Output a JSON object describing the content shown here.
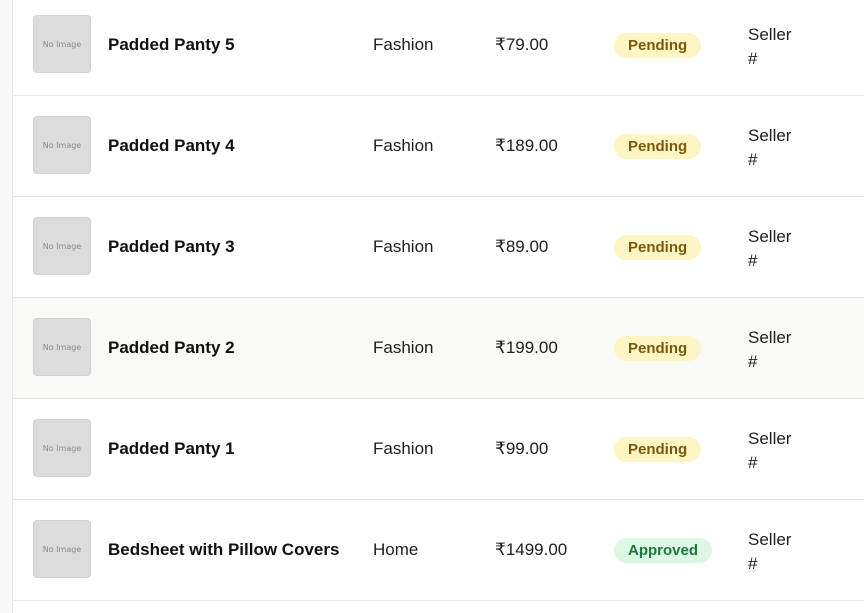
{
  "no_image_label": "No Image",
  "colors": {
    "pending_bg": "#fdf5c4",
    "pending_text": "#7a5a0a",
    "approved_bg": "#dcf7e4",
    "approved_text": "#1c7a3a"
  },
  "rows": [
    {
      "name": "Padded Panty 5",
      "category": "Fashion",
      "price": "₹79.00",
      "status": "Pending",
      "seller_line1": "Seller",
      "seller_line2": "#"
    },
    {
      "name": "Padded Panty 4",
      "category": "Fashion",
      "price": "₹189.00",
      "status": "Pending",
      "seller_line1": "Seller",
      "seller_line2": "#"
    },
    {
      "name": "Padded Panty 3",
      "category": "Fashion",
      "price": "₹89.00",
      "status": "Pending",
      "seller_line1": "Seller",
      "seller_line2": "#"
    },
    {
      "name": "Padded Panty 2",
      "category": "Fashion",
      "price": "₹199.00",
      "status": "Pending",
      "seller_line1": "Seller",
      "seller_line2": "#"
    },
    {
      "name": "Padded Panty 1",
      "category": "Fashion",
      "price": "₹99.00",
      "status": "Pending",
      "seller_line1": "Seller",
      "seller_line2": "#"
    },
    {
      "name": "Bedsheet with Pillow Covers",
      "category": "Home",
      "price": "₹1499.00",
      "status": "Approved",
      "seller_line1": "Seller",
      "seller_line2": "#"
    }
  ]
}
